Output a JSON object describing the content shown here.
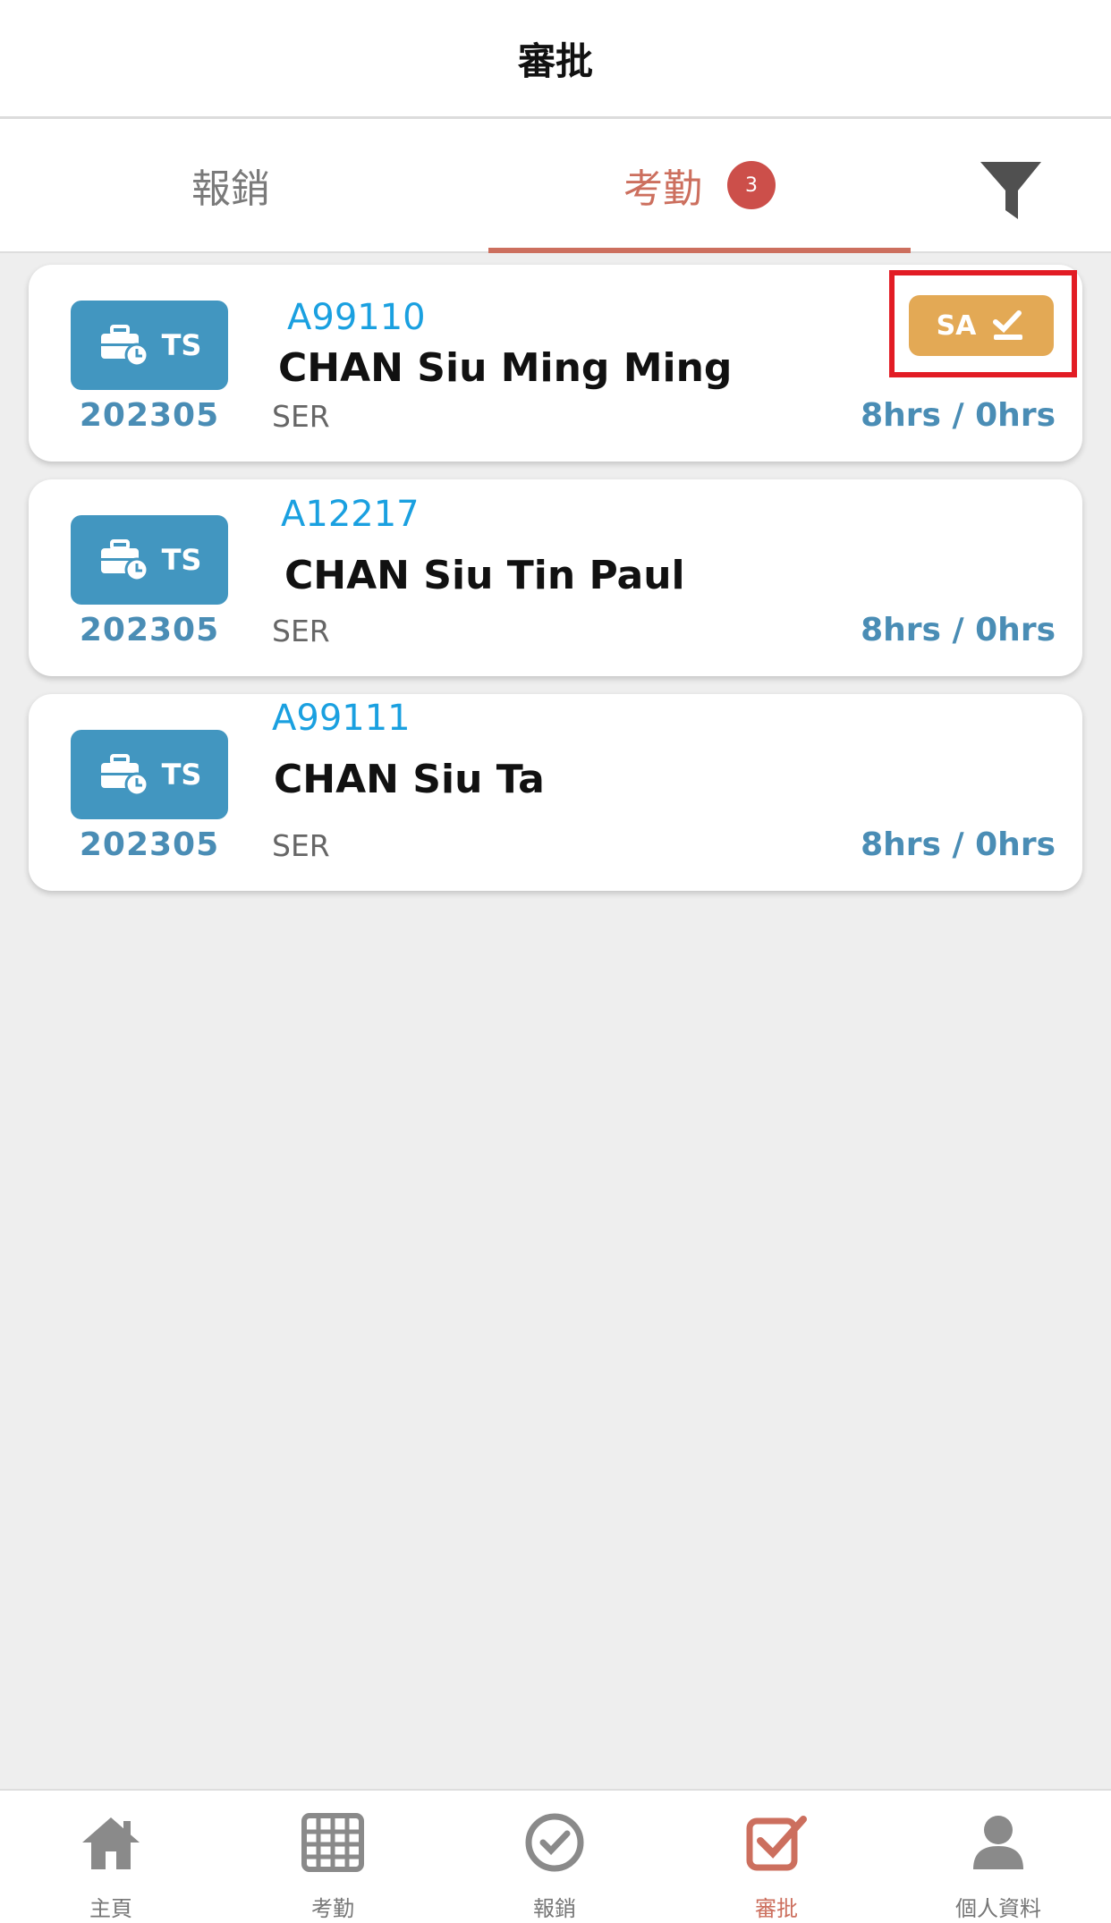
{
  "header": {
    "title": "審批"
  },
  "tabs": [
    {
      "label": "報銷"
    },
    {
      "label": "考勤",
      "badge": "3",
      "active": true
    }
  ],
  "filter_icon": "filter-icon",
  "records": [
    {
      "type": "TS",
      "period": "202305",
      "id": "A99110",
      "name": "CHAN Siu Ming Ming",
      "dept": "SER",
      "hours": "8hrs / 0hrs",
      "sa_label": "SA"
    },
    {
      "type": "TS",
      "period": "202305",
      "id": "A12217",
      "name": "CHAN Siu Tin Paul",
      "dept": "SER",
      "hours": "8hrs / 0hrs"
    },
    {
      "type": "TS",
      "period": "202305",
      "id": "A99111",
      "name": "CHAN Siu Ta",
      "dept": "SER",
      "hours": "8hrs / 0hrs"
    }
  ],
  "bottom_nav": [
    {
      "label": "主頁",
      "icon": "home-icon"
    },
    {
      "label": "考勤",
      "icon": "calendar-grid-icon"
    },
    {
      "label": "報銷",
      "icon": "check-circle-icon"
    },
    {
      "label": "審批",
      "icon": "approval-check-icon",
      "active": true
    },
    {
      "label": "個人資料",
      "icon": "profile-icon"
    }
  ],
  "colors": {
    "accent": "#cc6f5e",
    "ts_badge": "#4296c0",
    "id_text": "#1aa0e0",
    "hours_text": "#4a8db5",
    "sa_button": "#e3a955",
    "highlight": "#e21c24",
    "badge": "#cc4f4a"
  }
}
